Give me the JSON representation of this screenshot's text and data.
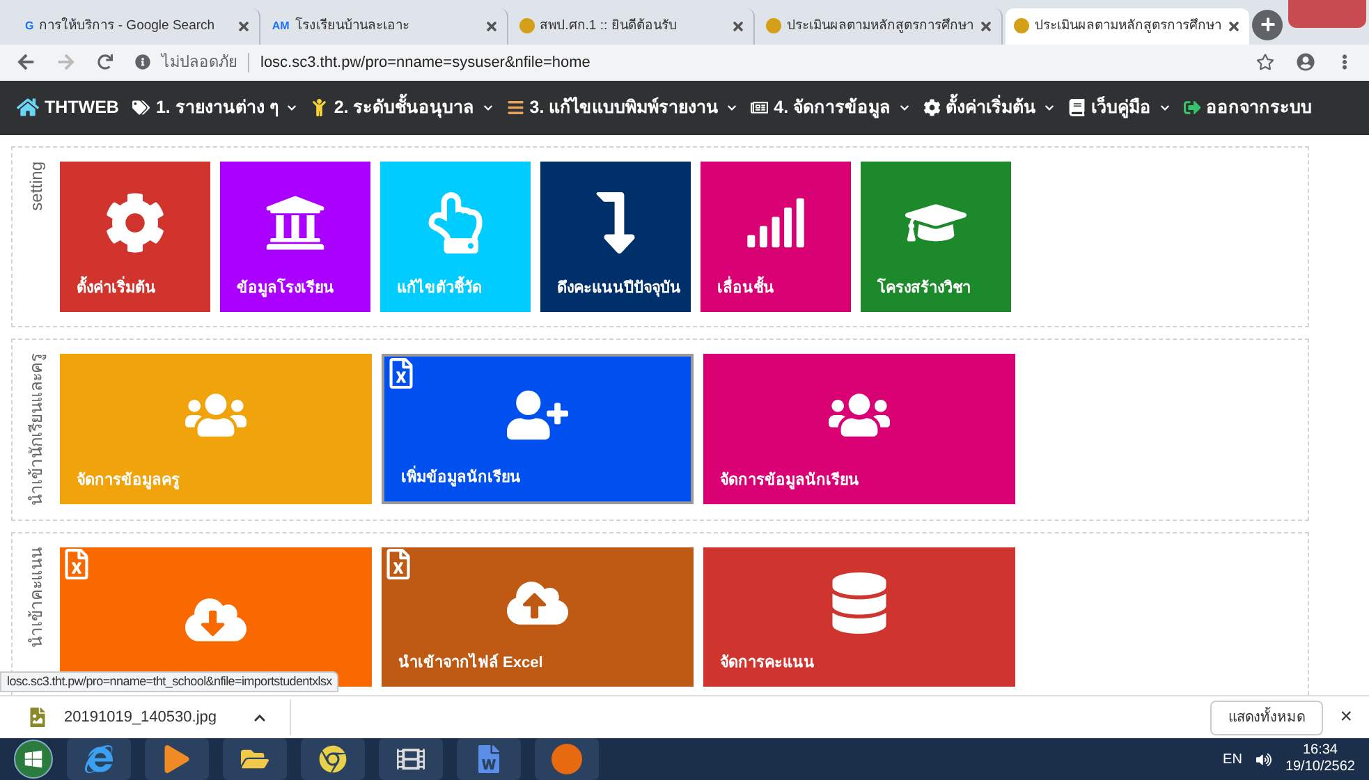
{
  "tabs": [
    {
      "title": "การให้บริการ - Google Search",
      "favicon": "G",
      "selected": false
    },
    {
      "title": "โรงเรียนบ้านละเอาะ",
      "favicon": "AM",
      "selected": false
    },
    {
      "title": "สพป.ศก.1 :: ยินดีต้อนรับ",
      "selected": false
    },
    {
      "title": "ประเมินผลตามหลักสูตรการศึกษา",
      "selected": false
    },
    {
      "title": "ประเมินผลตามหลักสูตรการศึกษา",
      "selected": true
    }
  ],
  "address_bar": {
    "security": "ไม่ปลอดภัย",
    "url": "losc.sc3.tht.pw/pro=nname=sysuser&nfile=home"
  },
  "navbar": [
    {
      "label": "THTWEB",
      "has_menu": false
    },
    {
      "label": "1. รายงานต่าง ๆ",
      "has_menu": true
    },
    {
      "label": "2. ระดับชั้นอนุบาล",
      "has_menu": true
    },
    {
      "label": "3. แก้ไขแบบพิมพ์รายงาน",
      "has_menu": true
    },
    {
      "label": "4. จัดการข้อมูล",
      "has_menu": true
    },
    {
      "label": "ตั้งค่าเริ่มต้น",
      "has_menu": true
    },
    {
      "label": "เว็บคู่มือ",
      "has_menu": true
    },
    {
      "label": "ออกจากระบบ",
      "has_menu": false
    }
  ],
  "sections": [
    {
      "title": "setting",
      "tiles": [
        {
          "label": "ตั้งค่าเริ่มต้น",
          "color": "#d0342c",
          "excel": false,
          "selected": false
        },
        {
          "label": "ข้อมูลโรงเรียน",
          "color": "#aa00ff",
          "excel": false,
          "selected": false
        },
        {
          "label": "แก้ไขตัวชี้วัด",
          "color": "#00ccff",
          "excel": false,
          "selected": false
        },
        {
          "label": "ดึงคะแนนปีปัจจุบัน",
          "color": "#00306a",
          "excel": false,
          "selected": false
        },
        {
          "label": "เลื่อนชั้น",
          "color": "#d80073",
          "excel": false,
          "selected": false
        },
        {
          "label": "โครงสร้างวิชา",
          "color": "#1c8a2a",
          "excel": false,
          "selected": false
        }
      ]
    },
    {
      "title": "นำเข้านักเรียนและครู",
      "tiles": [
        {
          "label": "จัดการข้อมูลครู",
          "color": "#f0a30a",
          "excel": false,
          "selected": false
        },
        {
          "label": "เพิ่มข้อมูลนักเรียน",
          "color": "#0050ef",
          "excel": true,
          "selected": true
        },
        {
          "label": "จัดการข้อมูลนักเรียน",
          "color": "#d80073",
          "excel": false,
          "selected": false
        }
      ]
    },
    {
      "title": "นำเข้าคะแนน",
      "tiles": [
        {
          "color": "#fa6800",
          "excel": true,
          "selected": false
        },
        {
          "label": "นำเข้าจากไฟล์ Excel",
          "color": "#bf5a15",
          "excel": true,
          "selected": false
        },
        {
          "label": "จัดการคะแนน",
          "color": "#cf352e",
          "excel": false,
          "selected": false
        }
      ]
    }
  ],
  "status_url": "losc.sc3.tht.pw/pro=nname=tht_school&nfile=importstudentxlsx",
  "downloads": {
    "file": "20191019_140530.jpg",
    "show_all": "แสดงทั้งหมด",
    "close": "×"
  },
  "taskbar": {
    "language": "EN",
    "time": "16:34",
    "date": "19/10/2562"
  }
}
